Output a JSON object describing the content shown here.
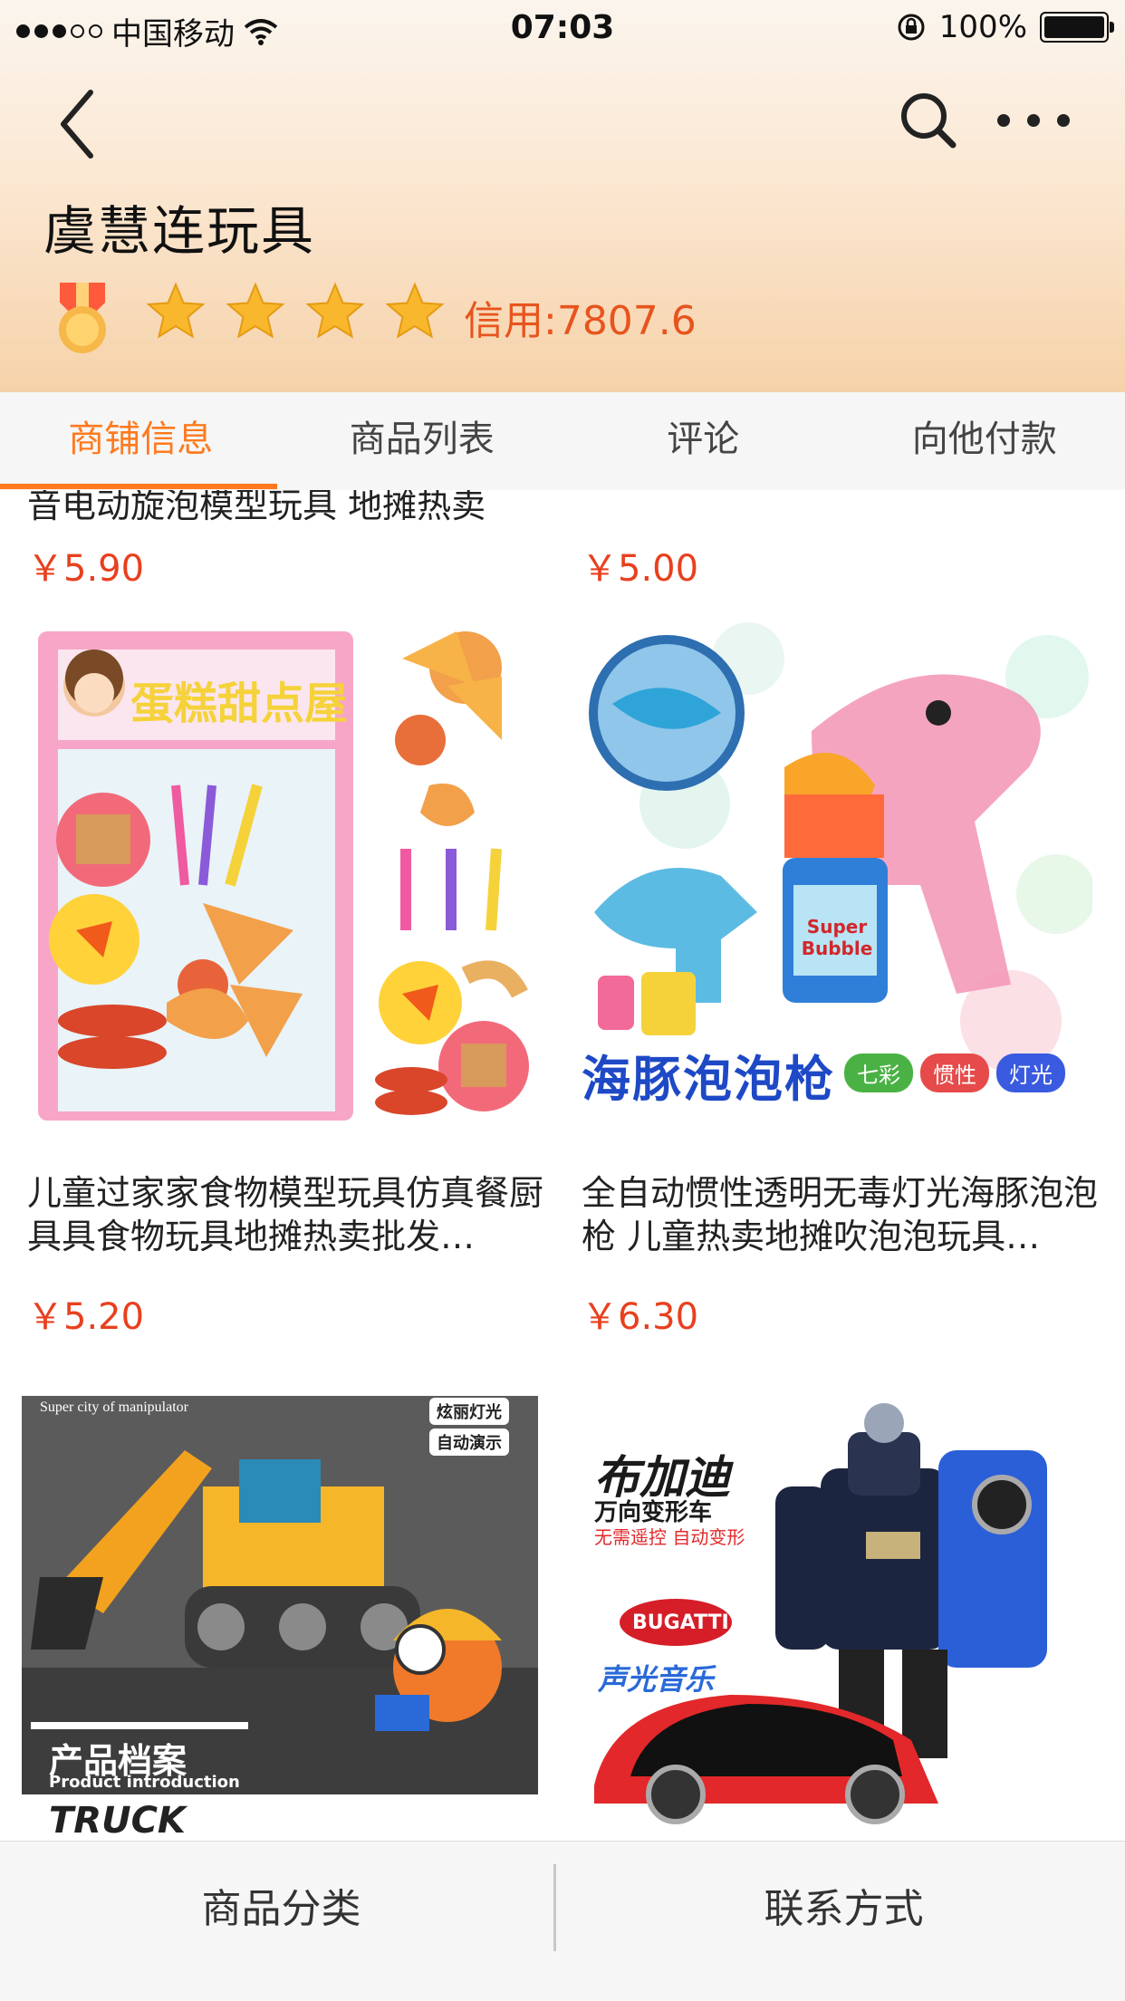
{
  "status_bar": {
    "carrier": "中国移动",
    "time": "07:03",
    "battery": "100%"
  },
  "shop": {
    "name": "虞慧连玩具",
    "star_count": 4,
    "credit": "信用:7807.6"
  },
  "tabs": [
    {
      "label": "商铺信息",
      "active": true
    },
    {
      "label": "商品列表",
      "active": false
    },
    {
      "label": "评论",
      "active": false
    },
    {
      "label": "向他付款",
      "active": false
    }
  ],
  "products": {
    "cut_off_title": "音电动旋泡模型玩具 地摊热卖",
    "row1_prices": [
      "￥5.90",
      "￥5.00"
    ],
    "items": [
      {
        "title": "儿童过家家食物模型玩具仿真餐厨具具食物玩具地摊热卖批发…",
        "price": "￥5.20",
        "image_caption": "蛋糕甜点屋"
      },
      {
        "title": "全自动惯性透明无毒灯光海豚泡泡枪 儿童热卖地摊吹泡泡玩具…",
        "price": "￥6.30",
        "image_caption": "海豚泡泡枪",
        "image_badges": [
          "七彩",
          "惯性",
          "灯光"
        ],
        "image_bottle": "Super Bubble"
      },
      {
        "image_caption_top": "Super city of manipulator",
        "image_badges": [
          "炫丽灯光",
          "自动演示"
        ],
        "image_caption": "产品档案",
        "image_subcaption": "Product introduction",
        "image_logo": "TRUCK"
      },
      {
        "image_caption": "布加迪",
        "image_subcaption": "万向变形车",
        "image_tagline": "无需遥控 自动变形",
        "image_logo": "BUGATTI",
        "image_footer": "声光音乐"
      }
    ]
  },
  "bottom_bar": {
    "left": "商品分类",
    "right": "联系方式"
  },
  "colors": {
    "accent": "#ff7a1f",
    "price": "#e8401e",
    "credit": "#e8541e"
  }
}
